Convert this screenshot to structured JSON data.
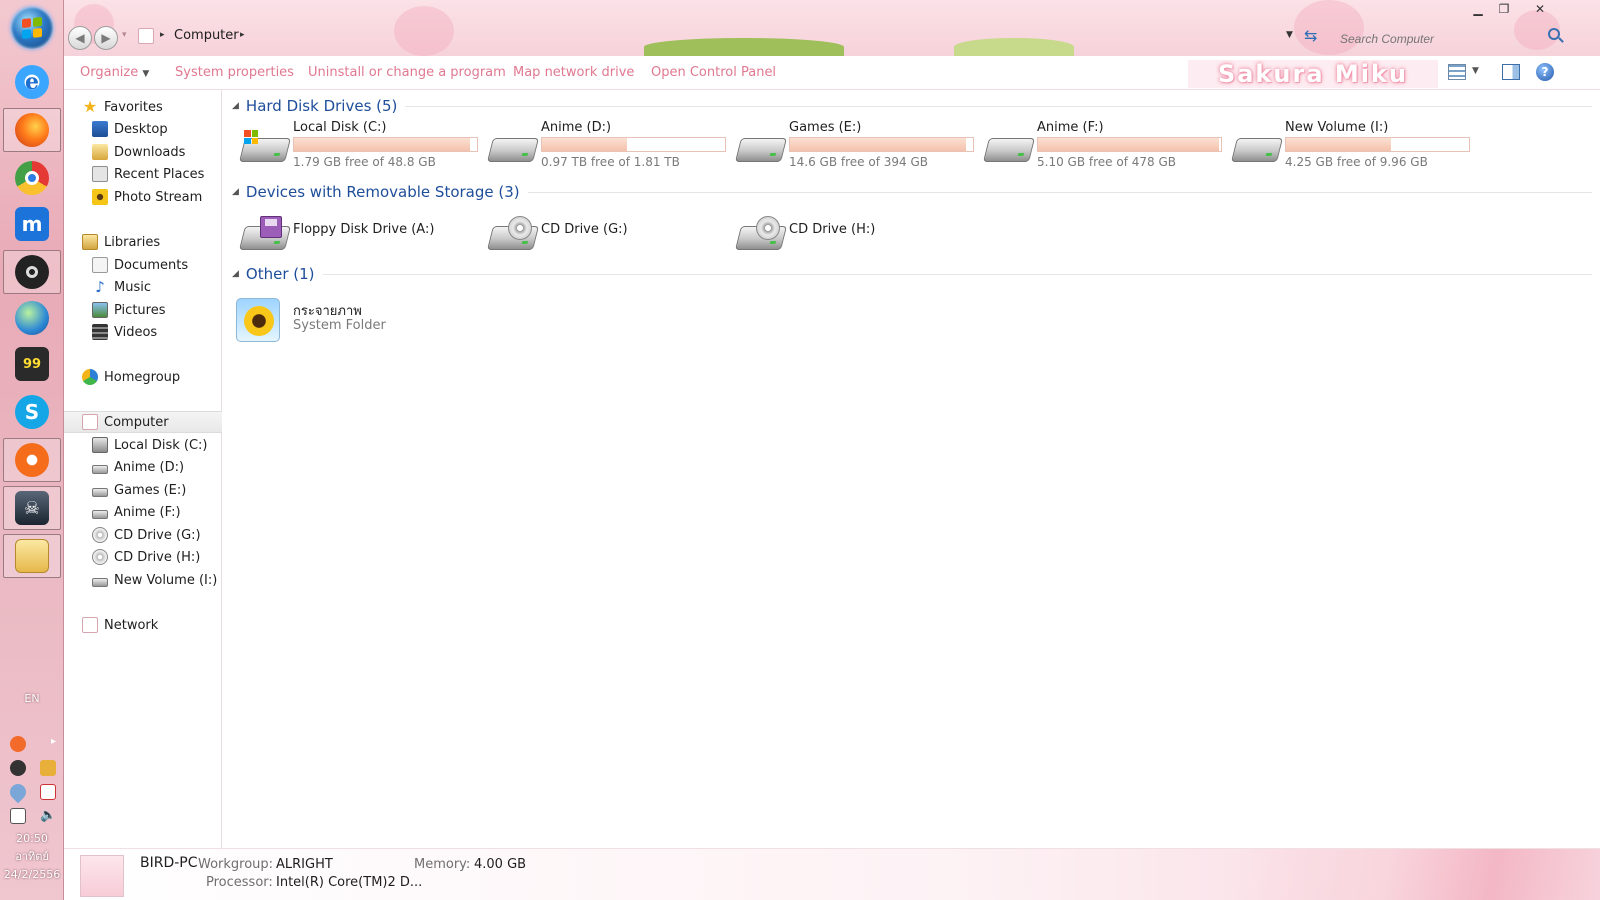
{
  "window": {
    "breadcrumb": [
      "Computer"
    ],
    "search_placeholder": "Search Computer",
    "brand_text": "Sakura Miku"
  },
  "toolbar": {
    "organize": "Organize",
    "system_properties": "System properties",
    "uninstall": "Uninstall or change a program",
    "map_drive": "Map network drive",
    "control_panel": "Open Control Panel"
  },
  "nav": {
    "favorites": {
      "label": "Favorites",
      "items": [
        {
          "label": "Desktop",
          "icon": "desktop-icon"
        },
        {
          "label": "Downloads",
          "icon": "downloads-icon"
        },
        {
          "label": "Recent Places",
          "icon": "recent-places-icon"
        },
        {
          "label": "Photo Stream",
          "icon": "photo-stream-icon"
        }
      ]
    },
    "libraries": {
      "label": "Libraries",
      "items": [
        {
          "label": "Documents",
          "icon": "documents-icon"
        },
        {
          "label": "Music",
          "icon": "music-icon"
        },
        {
          "label": "Pictures",
          "icon": "pictures-icon"
        },
        {
          "label": "Videos",
          "icon": "videos-icon"
        }
      ]
    },
    "homegroup": "Homegroup",
    "computer": {
      "label": "Computer",
      "items": [
        {
          "label": "Local Disk (C:)"
        },
        {
          "label": "Anime (D:)"
        },
        {
          "label": "Games (E:)"
        },
        {
          "label": "Anime (F:)"
        },
        {
          "label": "CD Drive (G:)"
        },
        {
          "label": "CD Drive (H:)"
        },
        {
          "label": "New Volume (I:)"
        }
      ]
    },
    "network": "Network"
  },
  "groups": {
    "hdd": {
      "title": "Hard Disk Drives (5)",
      "items": [
        {
          "name": "Local Disk (C:)",
          "free": "1.79 GB free of 48.8 GB",
          "used_fraction": 0.963
        },
        {
          "name": "Anime (D:)",
          "free": "0.97 TB free of 1.81 TB",
          "used_fraction": 0.464
        },
        {
          "name": "Games (E:)",
          "free": "14.6 GB free of 394 GB",
          "used_fraction": 0.963
        },
        {
          "name": "Anime (F:)",
          "free": "5.10 GB free of 478 GB",
          "used_fraction": 0.989
        },
        {
          "name": "New Volume (I:)",
          "free": "4.25 GB free of 9.96 GB",
          "used_fraction": 0.573
        }
      ]
    },
    "removable": {
      "title": "Devices with Removable Storage (3)",
      "items": [
        {
          "name": "Floppy Disk Drive (A:)"
        },
        {
          "name": "CD Drive (G:)"
        },
        {
          "name": "CD Drive (H:)"
        }
      ]
    },
    "other": {
      "title": "Other (1)",
      "items": [
        {
          "name": "กระจายภาพ",
          "type": "System Folder"
        }
      ]
    }
  },
  "details": {
    "pc_name": "BIRD-PC",
    "workgroup_label": "Workgroup:",
    "workgroup": "ALRIGHT",
    "memory_label": "Memory:",
    "memory": "4.00 GB",
    "processor_label": "Processor:",
    "processor": "Intel(R) Core(TM)2 D..."
  },
  "tray": {
    "lang": "EN",
    "time": "20:50",
    "day": "อาทิตย์",
    "date": "24/2/2556"
  },
  "colors": {
    "accent_pink": "#e07890",
    "group_title_blue": "#1e4d9a",
    "bar_fill": "#f4c2ac"
  }
}
